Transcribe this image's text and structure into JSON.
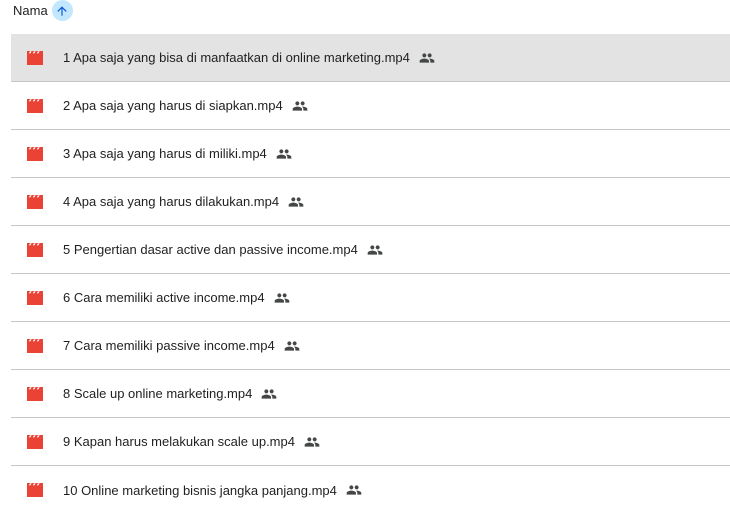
{
  "header": {
    "column_label": "Nama",
    "sort_icon": "arrow-upward-icon"
  },
  "colors": {
    "video_icon": "#ea4335",
    "sort_bg": "#c2e7ff",
    "selected_row_bg": "#e3e3e3",
    "divider": "#c7c7c7"
  },
  "files": [
    {
      "name": "1 Apa saja yang bisa di manfaatkan di online marketing.mp4",
      "type_icon": "video-file-icon",
      "shared_icon": "people-icon",
      "selected": true
    },
    {
      "name": "2 Apa saja yang harus di siapkan.mp4",
      "type_icon": "video-file-icon",
      "shared_icon": "people-icon",
      "selected": false
    },
    {
      "name": "3 Apa saja yang harus di miliki.mp4",
      "type_icon": "video-file-icon",
      "shared_icon": "people-icon",
      "selected": false
    },
    {
      "name": "4 Apa saja yang harus dilakukan.mp4",
      "type_icon": "video-file-icon",
      "shared_icon": "people-icon",
      "selected": false
    },
    {
      "name": "5 Pengertian dasar active dan passive income.mp4",
      "type_icon": "video-file-icon",
      "shared_icon": "people-icon",
      "selected": false
    },
    {
      "name": "6 Cara memiliki active income.mp4",
      "type_icon": "video-file-icon",
      "shared_icon": "people-icon",
      "selected": false
    },
    {
      "name": "7 Cara memiliki passive income.mp4",
      "type_icon": "video-file-icon",
      "shared_icon": "people-icon",
      "selected": false
    },
    {
      "name": "8 Scale up online marketing.mp4",
      "type_icon": "video-file-icon",
      "shared_icon": "people-icon",
      "selected": false
    },
    {
      "name": "9 Kapan harus melakukan scale up.mp4",
      "type_icon": "video-file-icon",
      "shared_icon": "people-icon",
      "selected": false
    },
    {
      "name": "10 Online marketing bisnis jangka panjang.mp4",
      "type_icon": "video-file-icon",
      "shared_icon": "people-icon",
      "selected": false
    }
  ]
}
